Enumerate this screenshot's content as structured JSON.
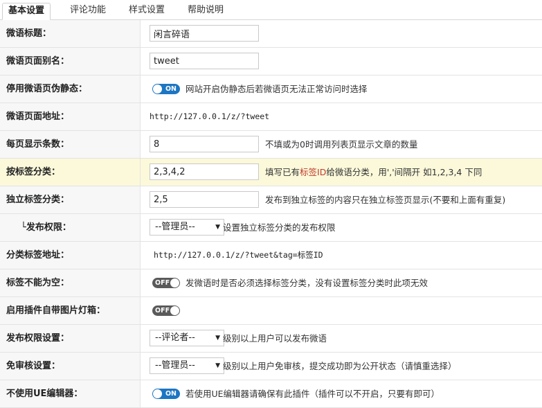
{
  "tabs": [
    "基本设置",
    "评论功能",
    "样式设置",
    "帮助说明"
  ],
  "rows": {
    "title": {
      "label": "微语标题：",
      "value": "闲言碎语"
    },
    "alias": {
      "label": "微语页面别名：",
      "value": "tweet"
    },
    "pseudo_static": {
      "label": "停用微语页伪静态：",
      "toggle": "ON",
      "desc": "网站开启伪静态后若微语页无法正常访问时选择"
    },
    "page_url": {
      "label": "微语页面地址：",
      "url": "http://127.0.0.1/z/?tweet"
    },
    "per_page": {
      "label": "每页显示条数：",
      "value": "8",
      "desc": "不填或为0时调用列表页显示文章的数量"
    },
    "tag_category": {
      "label": "按标签分类：",
      "value": "2,3,4,2",
      "desc_pre": "填写已有",
      "desc_red": "标签ID",
      "desc_post": "给微语分类，用','间隔开   如1,2,3,4 下同"
    },
    "independent_tag": {
      "label": "独立标签分类：",
      "value": "2,5",
      "desc": "发布到独立标签的内容只在独立标签页显示(不要和上面有重复)"
    },
    "publish_perm": {
      "label": "└发布权限：",
      "select": "--管理员--",
      "desc": "设置独立标签分类的发布权限"
    },
    "tag_url": {
      "label": "分类标签地址：",
      "url": "http://127.0.0.1/z/?tweet&tag=标签ID"
    },
    "tag_required": {
      "label": "标签不能为空：",
      "toggle": "OFF",
      "desc": "发微语时是否必须选择标签分类，没有设置标签分类时此项无效"
    },
    "lightbox": {
      "label": "启用插件自带图片灯箱：",
      "toggle": "OFF"
    },
    "publish_level": {
      "label": "发布权限设置：",
      "select": "--评论者--",
      "desc": "级别以上用户可以发布微语"
    },
    "audit_free": {
      "label": "免审核设置：",
      "select": "--管理员--",
      "desc": "级别以上用户免审核，提交成功即为公开状态（请慎重选择）"
    },
    "no_ue": {
      "label": "不使用UE编辑器：",
      "toggle": "ON",
      "desc": "若使用UE编辑器请确保有此插件（插件可以不开启，只要有即可）"
    }
  },
  "colors": {
    "toggle_on": "#1d76c3",
    "toggle_off": "#5a5a5a",
    "highlight_row": "#fbf9da",
    "red_text": "#c0392b"
  }
}
